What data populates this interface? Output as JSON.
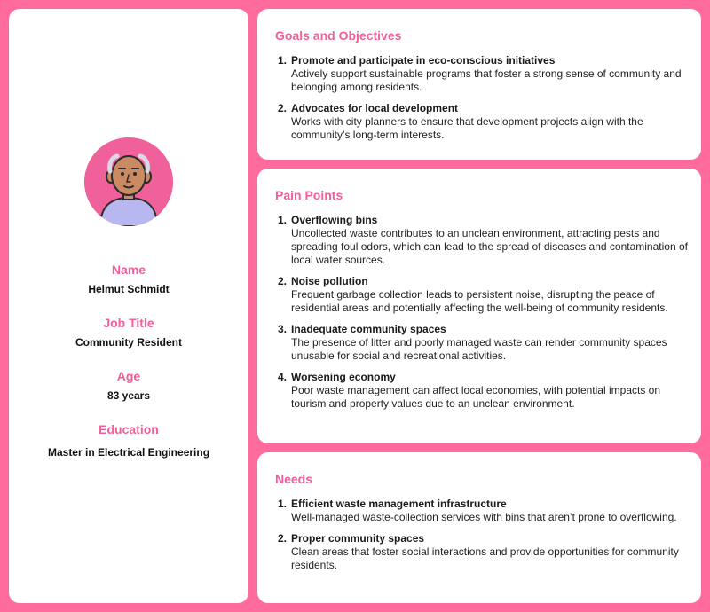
{
  "profile": {
    "avatar_icon": "elderly-man-avatar-icon",
    "name_label": "Name",
    "name": "Helmut Schmidt",
    "job_label": "Job Title",
    "job": "Community Resident",
    "age_label": "Age",
    "age": "83 years",
    "education_label": "Education",
    "education": "Master in Electrical Engineering"
  },
  "goals": {
    "title": "Goals and Objectives",
    "items": [
      {
        "num": "1.",
        "title": "Promote and participate in eco-conscious initiatives",
        "desc": "Actively support sustainable programs that foster a strong sense of community and belonging among residents."
      },
      {
        "num": "2.",
        "title": "Advocates for local development",
        "desc": "Works with city planners to ensure that development projects align with the community’s long-term interests."
      }
    ]
  },
  "pains": {
    "title": "Pain Points",
    "items": [
      {
        "num": "1.",
        "title": "Overflowing bins",
        "desc": "Uncollected waste contributes to an unclean environment, attracting pests and spreading foul odors, which can lead to the spread of diseases and contamination of local water sources."
      },
      {
        "num": "2.",
        "title": "Noise pollution",
        "desc": "Frequent garbage collection leads to persistent noise, disrupting the peace of residential areas and potentially affecting the well-being of community residents."
      },
      {
        "num": "3.",
        "title": "Inadequate community spaces",
        "desc": "The presence of litter and poorly managed waste can render community spaces unusable for social and recreational activities."
      },
      {
        "num": "4.",
        "title": "Worsening economy",
        "desc": "Poor waste management can affect local economies, with potential impacts on tourism and property values due to an unclean environment."
      }
    ]
  },
  "needs": {
    "title": "Needs",
    "items": [
      {
        "num": "1.",
        "title": "Efficient waste management infrastructure",
        "desc": "Well-managed waste-collection services with bins that aren’t prone to overflowing."
      },
      {
        "num": "2.",
        "title": "Proper community spaces",
        "desc": "Clean areas that foster social interactions and provide opportunities for community residents."
      }
    ]
  }
}
